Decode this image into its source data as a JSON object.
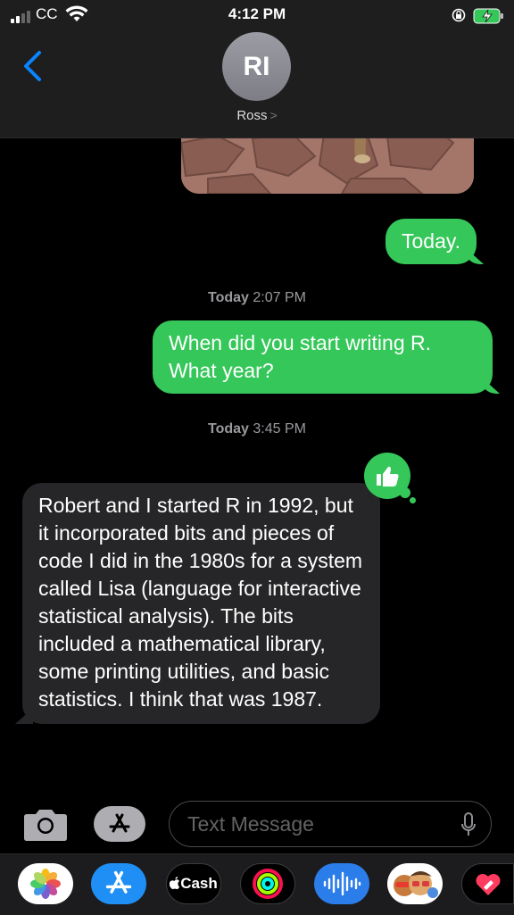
{
  "status_bar": {
    "carrier": "CC",
    "time": "4:12 PM"
  },
  "header": {
    "avatar_initials": "RI",
    "contact_name": "Ross",
    "chevron": ">"
  },
  "messages": [
    {
      "type": "image",
      "side": "sent"
    },
    {
      "type": "text",
      "side": "sent",
      "text": "Today."
    },
    {
      "type": "timestamp",
      "day": "Today",
      "time": "2:07 PM"
    },
    {
      "type": "text",
      "side": "sent",
      "text": "When did you start writing R. What year?"
    },
    {
      "type": "timestamp",
      "day": "Today",
      "time": "3:45 PM"
    },
    {
      "type": "text",
      "side": "received",
      "tapback": "thumbs-up",
      "text": "Robert and I started R in 1992, but it incorporated bits and pieces of code I did in the 1980s for a system called Lisa (language for interactive statistical analysis). The bits included a mathematical library, some printing utilities, and basic statistics. I think that was 1987."
    }
  ],
  "input": {
    "placeholder": "Text Message"
  },
  "app_drawer": [
    {
      "icon": "photos-icon"
    },
    {
      "icon": "app-store-icon"
    },
    {
      "icon": "apple-cash-icon",
      "label": "Cash"
    },
    {
      "icon": "activity-icon"
    },
    {
      "icon": "audio-message-icon"
    },
    {
      "icon": "memoji-icon"
    },
    {
      "icon": "digital-touch-icon"
    }
  ],
  "colors": {
    "sent_bubble": "#35c759",
    "received_bubble": "#262628",
    "accent": "#0a84ff"
  }
}
